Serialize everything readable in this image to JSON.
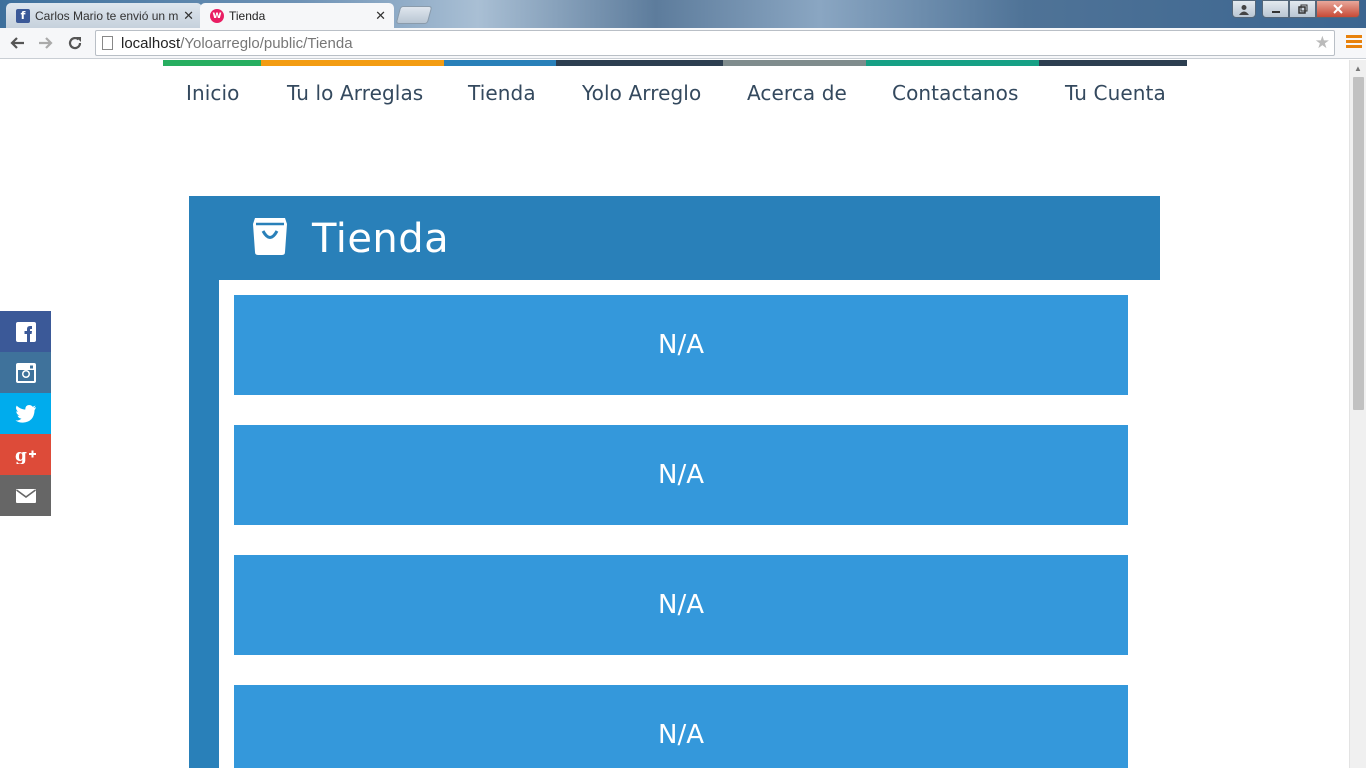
{
  "browser": {
    "tabs": [
      {
        "title": "Carlos Mario te envió un m",
        "favicon": "facebook-favicon",
        "active": false,
        "close": "✕"
      },
      {
        "title": "Tienda",
        "favicon": "yolo-favicon",
        "active": true,
        "close": "✕"
      }
    ],
    "url": {
      "host": "localhost",
      "path": "/Yoloarreglo/public/Tienda"
    },
    "icons": [
      "back-icon",
      "forward-icon",
      "reload-icon",
      "page-icon",
      "bookmark-star-icon",
      "chrome-menu-icon"
    ]
  },
  "nav": {
    "colors": [
      "#27ae60",
      "#f39c12",
      "#2980b9",
      "#2c3e50",
      "#7f8c8d",
      "#16a085",
      "#2c3e50"
    ],
    "items": [
      "Inicio",
      "Tu lo Arreglas",
      "Tienda",
      "Yolo Arreglo",
      "Acerca de",
      "Contactanos",
      "Tu Cuenta"
    ]
  },
  "store": {
    "title": "Tienda",
    "icon": "shopping-bag-icon",
    "products": [
      "N/A",
      "N/A",
      "N/A",
      "N/A"
    ],
    "colors": {
      "panel": "#2980b9",
      "card": "#3498db"
    }
  },
  "social": [
    {
      "name": "facebook",
      "icon": "facebook-icon",
      "color": "#3b5998"
    },
    {
      "name": "instagram",
      "icon": "instagram-icon",
      "color": "#3f729b"
    },
    {
      "name": "twitter",
      "icon": "twitter-icon",
      "color": "#00aced"
    },
    {
      "name": "google-plus",
      "icon": "google-plus-icon",
      "color": "#dd4b39"
    },
    {
      "name": "email",
      "icon": "email-icon",
      "color": "#666666"
    }
  ]
}
